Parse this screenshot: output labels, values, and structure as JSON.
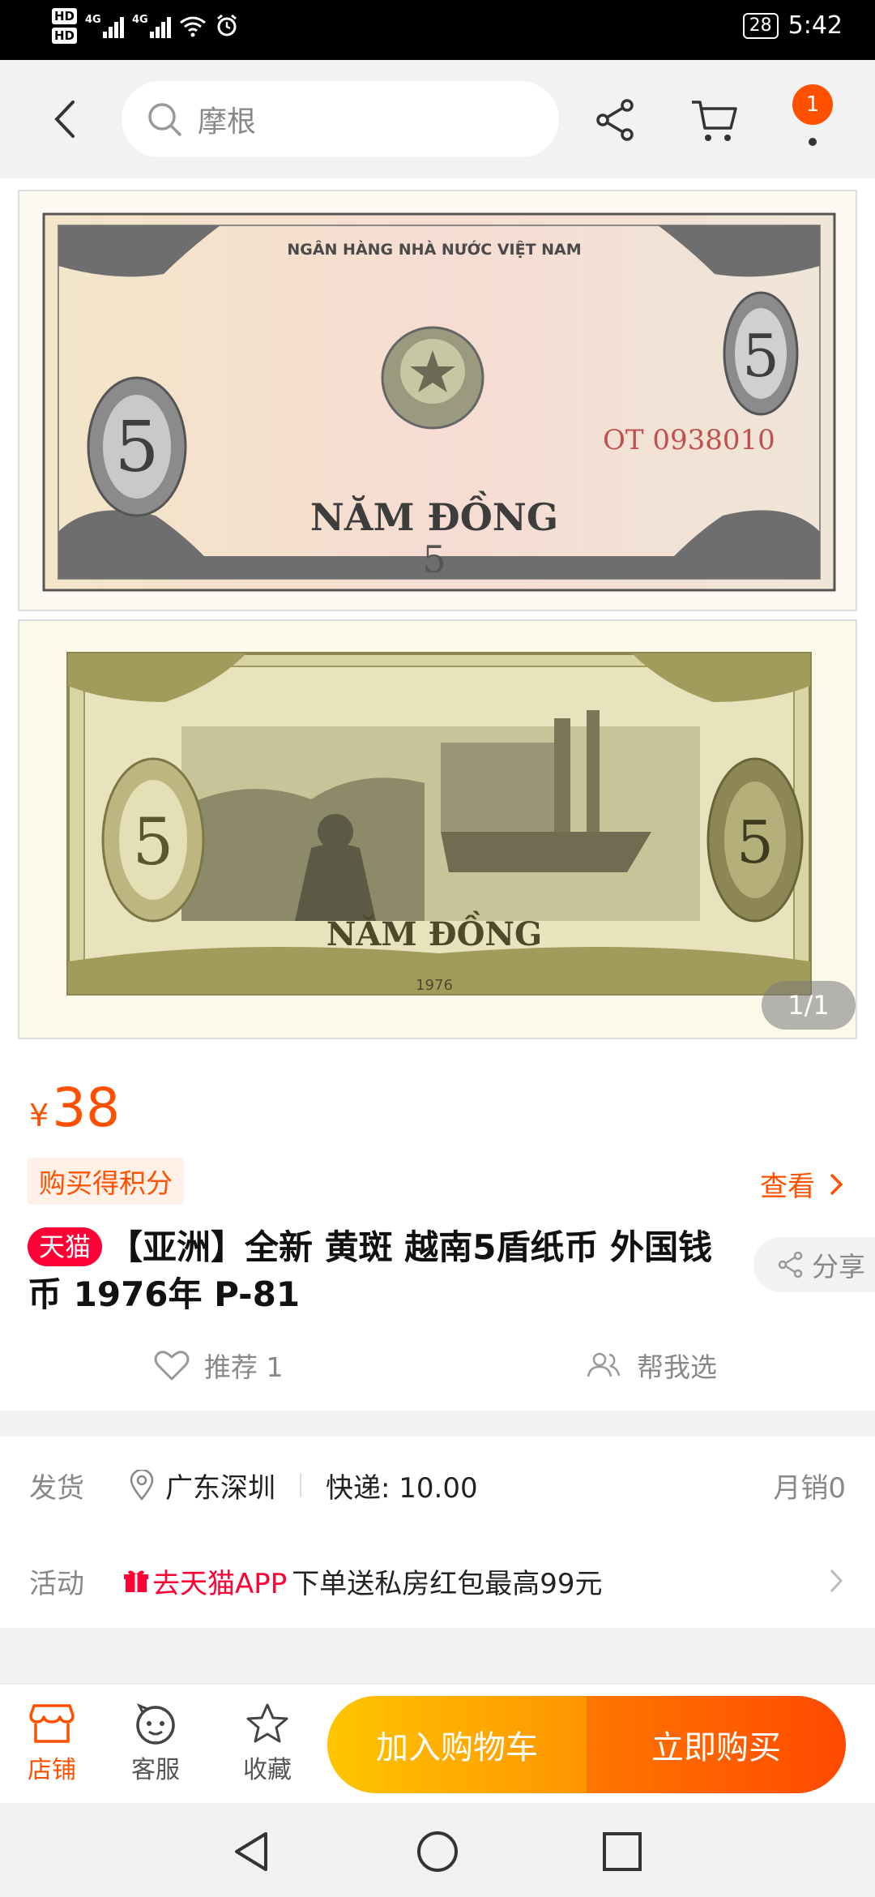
{
  "status_bar": {
    "hd1": "HD",
    "hd2": "HD",
    "net1": "4G",
    "net2": "4G",
    "battery": "28",
    "time": "5:42"
  },
  "nav": {
    "search_placeholder": "摩根",
    "badge_count": "1"
  },
  "gallery": {
    "front_bank": "NGÂN HÀNG NHÀ NƯỚC VIỆT NAM",
    "front_serial": "OT 0938010",
    "front_denomination": "NĂM ĐỒNG",
    "front_numeral": "5",
    "back_denomination": "NĂM ĐỒNG",
    "back_numeral": "5",
    "back_year": "1976",
    "pager": "1/1"
  },
  "product": {
    "currency": "¥",
    "price": "38",
    "points_tag": "购买得积分",
    "view_link": "查看",
    "tmall_badge": "天猫",
    "title": "【亚洲】全新 黄斑 越南5盾纸币 外国钱币 1976年 P-81",
    "share_label": "分享",
    "recommend_label": "推荐 1",
    "help_label": "帮我选"
  },
  "shipping": {
    "label": "发货",
    "location": "广东深圳",
    "express": "快递: 10.00",
    "monthly_sales": "月销0",
    "activity_label": "活动",
    "tmall_app": "去天猫APP",
    "activity_text": "下单送私房红包最高99元"
  },
  "action_bar": {
    "store": "店铺",
    "service": "客服",
    "favorite": "收藏",
    "add_cart": "加入购物车",
    "buy_now": "立即购买"
  },
  "colors": {
    "accent": "#ff5000",
    "tmall_red": "#ff0036",
    "cart_gradient_start": "#ffc500",
    "buy_gradient_end": "#ff4900"
  }
}
